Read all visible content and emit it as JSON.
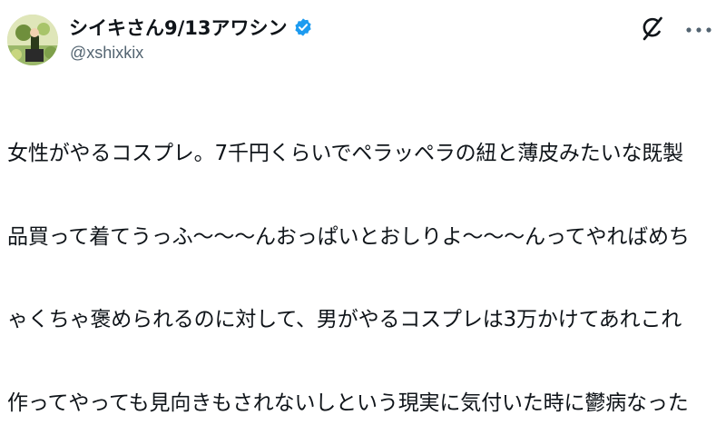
{
  "tweet": {
    "display_name": "シイキさん9/13アワシン",
    "handle": "@xshixkix",
    "verified": true,
    "accent_color": "#1d9bf0",
    "text_lines": [
      "女性がやるコスプレ。7千円くらいでペラッペラの紐と薄皮みたいな既製",
      "品買って着てうっふ～～～んおっぱいとおしりよ～～～んってやればめち",
      "ゃくちゃ褒められるのに対して、男がやるコスプレは3万かけてあれこれ",
      "作ってやっても見向きもされないしという現実に気付いた時に鬱病なった"
    ],
    "icons": {
      "avatar": "avatar",
      "verified": "verified-badge-icon",
      "grok": "grok-icon",
      "more": "more-options-icon"
    }
  }
}
